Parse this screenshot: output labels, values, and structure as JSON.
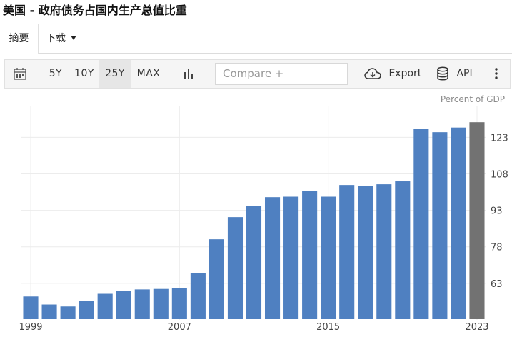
{
  "header": {
    "title": "美国 - 政府债务占国内生产总值比重"
  },
  "tabs": [
    {
      "label": "摘要",
      "active": true
    },
    {
      "label": "下载",
      "active": false
    }
  ],
  "toolbar": {
    "ranges": [
      "5Y",
      "10Y",
      "25Y",
      "MAX"
    ],
    "selected_range": "25Y",
    "compare_placeholder": "Compare +",
    "export_label": "Export",
    "api_label": "API"
  },
  "chart_data": {
    "type": "bar",
    "unit_label": "Percent of GDP",
    "categories": [
      "1999",
      "2000",
      "2001",
      "2002",
      "2003",
      "2004",
      "2005",
      "2006",
      "2007",
      "2008",
      "2009",
      "2010",
      "2011",
      "2012",
      "2013",
      "2014",
      "2015",
      "2016",
      "2017",
      "2018",
      "2019",
      "2020",
      "2021",
      "2022",
      "2023"
    ],
    "values": [
      57.6,
      54.3,
      53.5,
      55.9,
      58.7,
      59.8,
      60.5,
      60.7,
      61.1,
      67.3,
      81.1,
      90.2,
      94.7,
      98.4,
      98.6,
      100.8,
      98.6,
      103.4,
      103.1,
      103.7,
      104.9,
      126.5,
      125.1,
      127.0,
      129.2
    ],
    "highlight_color": "#727272",
    "bar_color": "#4f80c1",
    "ylim": [
      48,
      136
    ],
    "yticks": [
      63,
      78,
      93,
      108,
      123
    ],
    "xtick_labels": [
      "1999",
      "2007",
      "2015",
      "2023"
    ],
    "grid": true
  }
}
